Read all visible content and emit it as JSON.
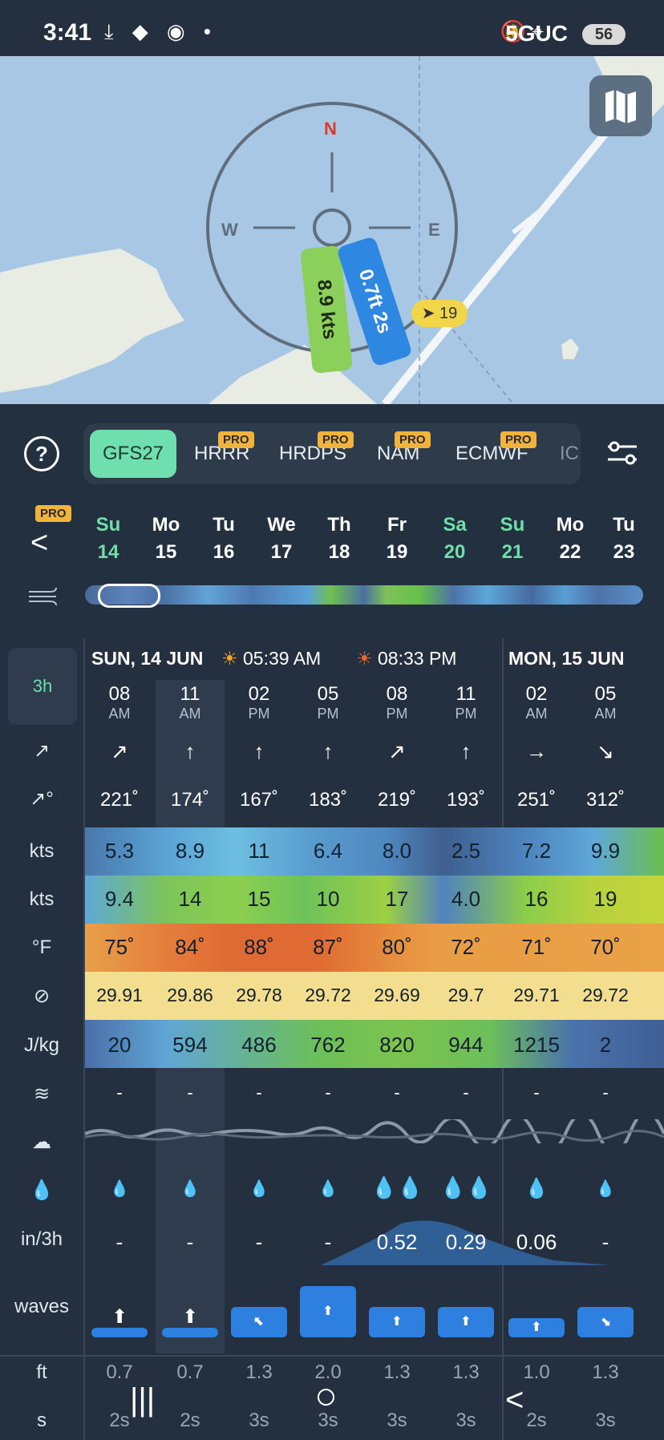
{
  "status_bar": {
    "time": "3:41",
    "left_icons": "⤓ ◆ ◉ •",
    "right_icons": "🔕 ⌖",
    "network": "5GUC",
    "battery": "56"
  },
  "map": {
    "compass": {
      "n": "N",
      "e": "E",
      "w": "W"
    },
    "wind_label": "8.9 kts",
    "wave_label": "0.7ft 2s",
    "speed_badge": "19"
  },
  "models": {
    "help_label": "?",
    "tabs": [
      {
        "label": "GFS27",
        "pro": ""
      },
      {
        "label": "HRRR",
        "pro": "PRO"
      },
      {
        "label": "HRDPS",
        "pro": "PRO"
      },
      {
        "label": "NAM",
        "pro": "PRO"
      },
      {
        "label": "ECMWF",
        "pro": "PRO"
      },
      {
        "label": "IC",
        "pro": ""
      }
    ]
  },
  "days": {
    "back_label": "<",
    "pro_label": "PRO",
    "items": [
      {
        "dow": "Su",
        "num": "14"
      },
      {
        "dow": "Mo",
        "num": "15"
      },
      {
        "dow": "Tu",
        "num": "16"
      },
      {
        "dow": "We",
        "num": "17"
      },
      {
        "dow": "Th",
        "num": "18"
      },
      {
        "dow": "Fr",
        "num": "19"
      },
      {
        "dow": "Sa",
        "num": "20"
      },
      {
        "dow": "Su",
        "num": "21"
      },
      {
        "dow": "Mo",
        "num": "22"
      },
      {
        "dow": "Tu",
        "num": "23"
      }
    ]
  },
  "table": {
    "interval": "3h",
    "day1": "SUN, 14 JUN",
    "sunrise": "05:39 AM",
    "sunset": "08:33 PM",
    "day2": "MON, 15 JUN",
    "hours": [
      {
        "h": "08",
        "ap": "AM"
      },
      {
        "h": "11",
        "ap": "AM"
      },
      {
        "h": "02",
        "ap": "PM"
      },
      {
        "h": "05",
        "ap": "PM"
      },
      {
        "h": "08",
        "ap": "PM"
      },
      {
        "h": "11",
        "ap": "PM"
      },
      {
        "h": "02",
        "ap": "AM"
      },
      {
        "h": "05",
        "ap": "AM"
      }
    ],
    "labels": {
      "dir": "↗",
      "deg": "↗°",
      "wind": "kts",
      "gust": "kts",
      "temp": "°F",
      "pressure": "⊘",
      "cape": "J/kg",
      "fog": "≋",
      "cloud": "☁",
      "rain": "💧",
      "precip": "in/3h",
      "waves": "waves",
      "ft": "ft",
      "s": "s"
    },
    "dir_arrows": [
      "↗",
      "↑",
      "↑",
      "↑",
      "↗",
      "↑",
      "→",
      "↘"
    ],
    "degrees": [
      "221˚",
      "174˚",
      "167˚",
      "183˚",
      "219˚",
      "193˚",
      "251˚",
      "312˚"
    ],
    "wind": [
      "5.3",
      "8.9",
      "11",
      "6.4",
      "8.0",
      "2.5",
      "7.2",
      "9.9"
    ],
    "gust": [
      "9.4",
      "14",
      "15",
      "10",
      "17",
      "4.0",
      "16",
      "19"
    ],
    "temp": [
      "75˚",
      "84˚",
      "88˚",
      "87˚",
      "80˚",
      "72˚",
      "71˚",
      "70˚"
    ],
    "pressure": [
      "29.91",
      "29.86",
      "29.78",
      "29.72",
      "29.69",
      "29.7",
      "29.71",
      "29.72"
    ],
    "cape": [
      "20",
      "594",
      "486",
      "762",
      "820",
      "944",
      "1215",
      "2"
    ],
    "fog": [
      "-",
      "-",
      "-",
      "-",
      "-",
      "-",
      "-",
      "-"
    ],
    "precip": [
      "-",
      "-",
      "-",
      "-",
      "0.52",
      "0.29",
      "0.06",
      "-"
    ],
    "wave_ft": [
      "0.7",
      "0.7",
      "1.3",
      "2.0",
      "1.3",
      "1.3",
      "1.0",
      "1.3"
    ],
    "wave_s": [
      "2s",
      "2s",
      "3s",
      "3s",
      "3s",
      "3s",
      "2s",
      "3s"
    ]
  },
  "colors": {
    "accent": "#6fdfb0",
    "pro": "#f2b33d",
    "wave": "#2d7fe0",
    "wind_pill": "#8ad05a"
  },
  "nav": {
    "recent": "|||",
    "home": "○",
    "back": "<"
  }
}
